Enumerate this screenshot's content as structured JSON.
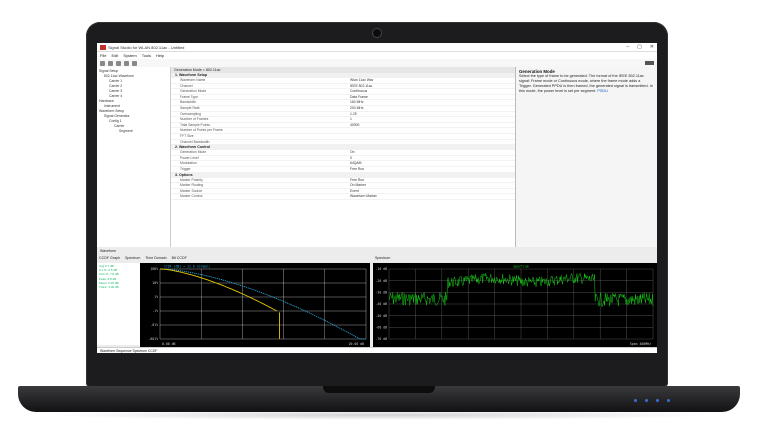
{
  "window": {
    "title": "Signal Studio for WLAN 802.11ac - Untitled",
    "controls": [
      "–",
      "▢",
      "✕"
    ]
  },
  "menu": [
    "File",
    "Edit",
    "System",
    "Tools",
    "Help"
  ],
  "tree": [
    "Signal Setup",
    "802.11ac Waveform",
    "Carrier 1",
    "Carrier 2",
    "Carrier 3",
    "Carrier 4",
    "Hardware",
    "Instrument",
    "Waveform Setup",
    "Signal Generator",
    "Config 1",
    "Carrier",
    "Segment"
  ],
  "props": {
    "header": "Generation Mode = 802.11ac",
    "group1": "1. Waveform Setup",
    "rows1": [
      {
        "k": "Waveform Name",
        "v": "Wlan 11ac Wav"
      },
      {
        "k": "Channel",
        "v": "IEEE 802.11ac"
      },
      {
        "k": "Generation Mode",
        "v": "Continuous"
      },
      {
        "k": "Frame Type",
        "v": "Data Frame"
      },
      {
        "k": "Bandwidth",
        "v": "160 MHz"
      },
      {
        "k": "Sample Rate",
        "v": "200 MHz"
      },
      {
        "k": "Oversampling",
        "v": "1.25"
      },
      {
        "k": "Number of Frames",
        "v": "1"
      },
      {
        "k": "Total Sample Points",
        "v": "40000"
      },
      {
        "k": "Number of Points per Frame",
        "v": ""
      },
      {
        "k": "FFT Size",
        "v": ""
      },
      {
        "k": "Channel Bandwidth",
        "v": ""
      }
    ],
    "group2": "2. Waveform Control",
    "rows2": [
      {
        "k": "Generation Mode",
        "v": "On"
      },
      {
        "k": "Power Level",
        "v": "0"
      },
      {
        "k": "Modulation",
        "v": "64QAM"
      },
      {
        "k": "Trigger",
        "v": "Free Run"
      }
    ],
    "group3": "3. Options",
    "rows3": [
      {
        "k": "Marker Polarity",
        "v": "Free Run"
      },
      {
        "k": "Marker Routing",
        "v": "On Marker"
      },
      {
        "k": "Marker Source",
        "v": "Event"
      },
      {
        "k": "Marker Control",
        "v": "Waveform Marker"
      }
    ]
  },
  "help": {
    "title": "Generation Mode",
    "text": "Select the type of frame to be generated. The format of the IEEE 802.11ac signal: Frame mode or Continuous mode, where the frame mode adds a Trigger. Generated PPDU is then framed, the generated signal is transmitted. In this mode, the power level is set per segment.",
    "link": "PSDU"
  },
  "lower": {
    "tab_label": "Waveform",
    "ccdf_tabs": [
      "CCDF Graph",
      "Spectrum",
      "Time Domain",
      "Bit CCDF"
    ],
    "ccdf_legend": [
      "Avg 2.7 dB",
      "0.1 %: 6.5 dB",
      "0.01 %: 7.8 dB",
      "Peak: 8.8 dB",
      "Mean: 0.00 dB",
      "Trace: 3.00 dB"
    ],
    "ccdf_header": "CCDF (dB) = 12.0 (Graph)",
    "ccdf_yticks": [
      "100%",
      "10%",
      "1%",
      ".1%",
      ".01%",
      ".001%"
    ],
    "ccdf_xleft": "0.00 dB",
    "ccdf_xright": "20.00 dB",
    "spec_tab": "Spectrum",
    "spec_header": "Spectrum",
    "spec_yticks": [
      "-10 dB",
      "-20 dB",
      "-30 dB",
      "-40 dB",
      "-50 dB",
      "-60 dB",
      "-70 dB"
    ],
    "spec_xright": "Span 400MHz",
    "status": "Waveform Sequence   Spectrum   CCDF"
  },
  "colors": {
    "ccdf_ref": "#2aa8d8",
    "ccdf_sig": "#e5c800",
    "grid": "#ffffff",
    "spectrum": "#18d018",
    "accent": "#c0312b"
  }
}
